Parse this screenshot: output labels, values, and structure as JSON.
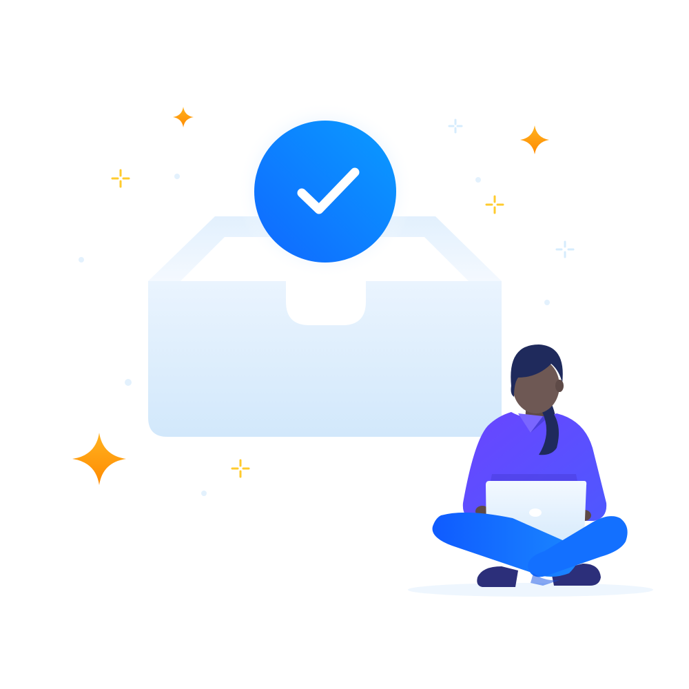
{
  "illustration": {
    "subject": "inbox-zero-success",
    "icons": {
      "tray": "inbox-tray-icon",
      "badge": "check-badge-icon",
      "check": "checkmark-icon",
      "laptop": "laptop-icon",
      "sparkle": "sparkle-icon"
    },
    "colors": {
      "background": "#ffffff",
      "tray_light": "#eaf4fe",
      "tray_dark": "#d2e8fb",
      "badge_start": "#0a9bff",
      "badge_end": "#1068ff",
      "check": "#ffffff",
      "sparkle_orange": "#ff9f0a",
      "sparkle_yellow": "#ffcb2e",
      "sparkle_pale": "#d6ecfd",
      "hair": "#1f2a5c",
      "skin": "#6e5854",
      "sweater": "#5b4bff",
      "pants": "#1268ff",
      "shoes": "#2c2f7a",
      "laptop": "#e8f3fd"
    }
  }
}
